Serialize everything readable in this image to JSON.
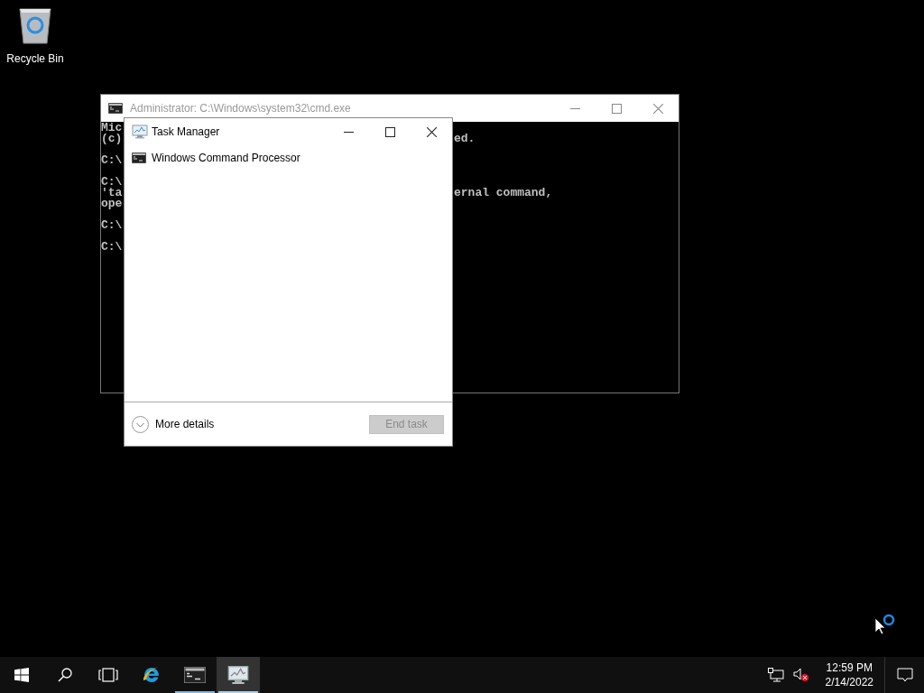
{
  "desktop": {
    "icons": [
      {
        "label": "Recycle Bin"
      }
    ]
  },
  "cmd_window": {
    "title": "Administrator: C:\\Windows\\system32\\cmd.exe",
    "lines": [
      {
        "kind": "text",
        "left": "Mic"
      },
      {
        "kind": "text",
        "left": "(c)",
        "right": "ed."
      },
      {
        "kind": "blank"
      },
      {
        "kind": "text",
        "left": "C:\\"
      },
      {
        "kind": "blank"
      },
      {
        "kind": "text",
        "left": "C:\\"
      },
      {
        "kind": "text",
        "left": "'ta",
        "right": "ernal command,"
      },
      {
        "kind": "text",
        "left": "ope"
      },
      {
        "kind": "blank"
      },
      {
        "kind": "text",
        "left": "C:\\"
      },
      {
        "kind": "blank"
      },
      {
        "kind": "text",
        "left": "C:\\"
      }
    ]
  },
  "task_manager": {
    "title": "Task Manager",
    "apps": [
      {
        "name": "Windows Command Processor",
        "selected": false
      }
    ],
    "more_details": "More details",
    "end_task": {
      "label": "End task",
      "disabled": true
    }
  },
  "taskbar": {
    "items": [
      {
        "kind": "start",
        "running": false,
        "selected": false
      },
      {
        "kind": "search",
        "running": false,
        "selected": false
      },
      {
        "kind": "taskview",
        "running": false,
        "selected": false
      },
      {
        "kind": "browser",
        "running": false,
        "selected": false
      },
      {
        "kind": "console",
        "running": true,
        "selected": false
      },
      {
        "kind": "taskmanager",
        "running": true,
        "selected": true
      }
    ],
    "clock": {
      "time": "12:59 PM",
      "date": "2/14/2022"
    }
  }
}
